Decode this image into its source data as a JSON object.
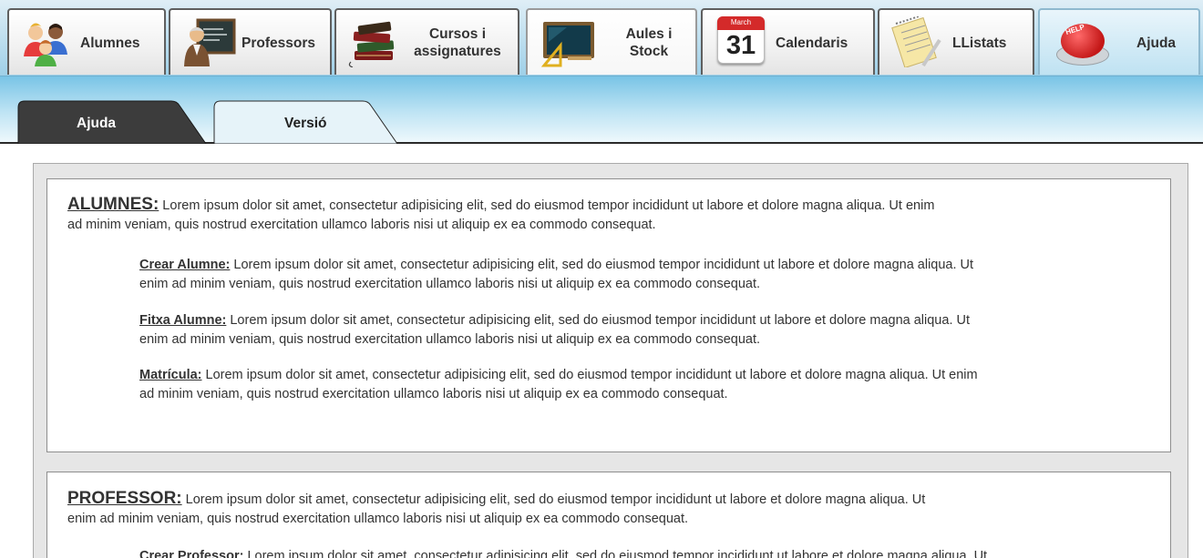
{
  "nav": {
    "tabs": [
      {
        "id": "alumnes",
        "label": "Alumnes",
        "icon": "students-icon"
      },
      {
        "id": "professors",
        "label": "Professors",
        "icon": "teacher-icon"
      },
      {
        "id": "cursos",
        "label": "Cursos i assignatures",
        "line1": "Cursos i",
        "line2": "assignatures",
        "icon": "books-icon"
      },
      {
        "id": "aules",
        "label": "Aules i Stock",
        "line1": "Aules i",
        "line2": "Stock",
        "icon": "blackboard-icon"
      },
      {
        "id": "calendaris",
        "label": "Calendaris",
        "icon": "calendar-icon",
        "calendar_month": "March",
        "calendar_day": "31"
      },
      {
        "id": "llistats",
        "label": "LListats",
        "icon": "notepad-icon"
      },
      {
        "id": "ajuda",
        "label": "Ajuda",
        "icon": "help-button-icon",
        "badge": "HELP"
      }
    ],
    "active": "aules"
  },
  "subtabs": [
    {
      "label": "Ajuda",
      "active": true
    },
    {
      "label": "Versió",
      "active": false
    }
  ],
  "sections": [
    {
      "title": "ALUMNES:",
      "text1": " Lorem ipsum dolor sit amet, consectetur adipisicing elit, sed do eiusmod tempor incididunt ut labore et dolore magna aliqua. Ut enim",
      "text2": "ad minim veniam, quis nostrud exercitation ullamco laboris nisi ut aliquip ex ea commodo consequat.",
      "items": [
        {
          "title": "Crear Alumne:",
          "text1": " Lorem ipsum dolor sit amet, consectetur adipisicing elit, sed do eiusmod tempor incididunt ut labore et dolore magna aliqua. Ut",
          "text2": "enim ad minim veniam, quis nostrud exercitation ullamco laboris nisi ut aliquip ex ea commodo consequat."
        },
        {
          "title": "Fitxa Alumne:",
          "text1": " Lorem ipsum dolor sit amet, consectetur adipisicing elit, sed do eiusmod tempor incididunt ut labore et dolore magna aliqua. Ut",
          "text2": "enim ad minim veniam, quis nostrud exercitation ullamco laboris nisi ut aliquip ex ea commodo consequat."
        },
        {
          "title": "Matrícula:",
          "text1": " Lorem ipsum dolor sit amet, consectetur adipisicing elit, sed do eiusmod tempor incididunt ut labore et dolore magna aliqua. Ut enim",
          "text2": "ad minim veniam, quis nostrud exercitation ullamco laboris nisi ut aliquip ex ea commodo consequat."
        }
      ]
    },
    {
      "title": "PROFESSOR:",
      "text1": " Lorem ipsum dolor sit amet, consectetur adipisicing elit, sed do eiusmod tempor incididunt ut labore et dolore magna aliqua. Ut",
      "text2": "enim ad minim veniam, quis nostrud exercitation ullamco laboris nisi ut aliquip ex ea commodo consequat.",
      "items": [
        {
          "title": "Crear Professor:",
          "text1": " Lorem ipsum dolor sit amet, consectetur adipisicing elit, sed do eiusmod tempor incididunt ut labore et dolore magna aliqua. Ut"
        }
      ]
    }
  ],
  "colors": {
    "band_top": "#79c4e6",
    "band_bottom": "#eef8fc",
    "active_subtab": "#3d3d3d",
    "inactive_subtab": "#e6f3f9",
    "help_red": "#d42a2a"
  }
}
